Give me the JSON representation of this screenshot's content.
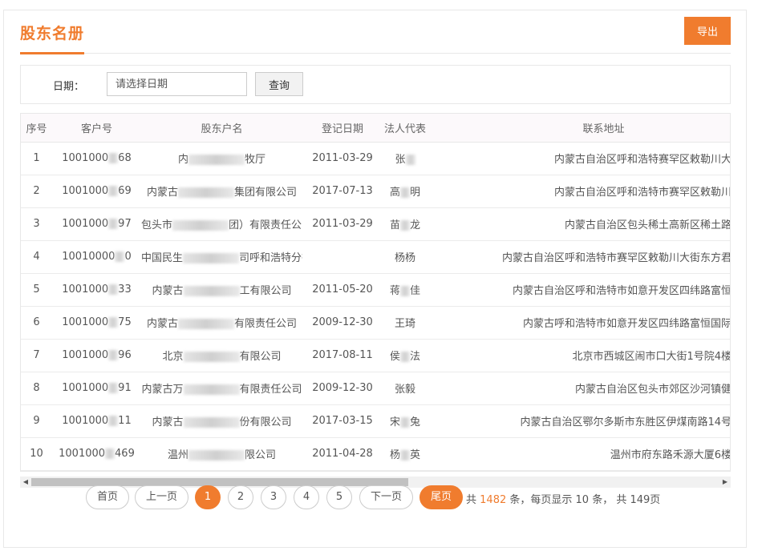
{
  "page": {
    "title": "股东名册",
    "export_label": "导出"
  },
  "filter": {
    "date_label": "日期：",
    "date_placeholder": "请选择日期",
    "query_label": "查询"
  },
  "table": {
    "columns": [
      "序号",
      "客户号",
      "股东户名",
      "登记日期",
      "法人代表",
      "联系地址"
    ],
    "rows": [
      {
        "idx": "1",
        "cid_a": "1001000",
        "cid_b": "68",
        "name_a": "内",
        "name_b": "牧厅",
        "date": "2011-03-29",
        "rep_a": "张",
        "rep_b": "",
        "addr": "内蒙古自治区呼和浩特赛罕区敕勒川大"
      },
      {
        "idx": "2",
        "cid_a": "1001000",
        "cid_b": "69",
        "name_a": "内蒙古",
        "name_b": "集团有限公司",
        "date": "2017-07-13",
        "rep_a": "高",
        "rep_b": "明",
        "addr": "内蒙古自治区呼和浩特市赛罕区敕勒川"
      },
      {
        "idx": "3",
        "cid_a": "1001000",
        "cid_b": "97",
        "name_a": "包头市",
        "name_b": "团）有限责任公司",
        "date": "2011-03-29",
        "rep_a": "苗",
        "rep_b": "龙",
        "addr": "内蒙古自治区包头稀土高新区稀土路"
      },
      {
        "idx": "4",
        "cid_a": "10010000",
        "cid_b": "0",
        "name_a": "中国民生",
        "name_b": "司呼和浩特分行",
        "date": "",
        "rep_a": "杨杨",
        "rep_b": "",
        "addr": "内蒙古自治区呼和浩特市赛罕区敕勒川大街东方君"
      },
      {
        "idx": "5",
        "cid_a": "1001000",
        "cid_b": "33",
        "name_a": "内蒙古",
        "name_b": "工有限公司",
        "date": "2011-05-20",
        "rep_a": "蒋",
        "rep_b": "佳",
        "addr": "内蒙古自治区呼和浩特市如意开发区四纬路富恒"
      },
      {
        "idx": "6",
        "cid_a": "1001000",
        "cid_b": "75",
        "name_a": "内蒙古",
        "name_b": "有限责任公司",
        "date": "2009-12-30",
        "rep_a": "王琦",
        "rep_b": "",
        "addr": "内蒙古呼和浩特市如意开发区四纬路富恒国际"
      },
      {
        "idx": "7",
        "cid_a": "1001000",
        "cid_b": "96",
        "name_a": "北京",
        "name_b": "有限公司",
        "date": "2017-08-11",
        "rep_a": "侯",
        "rep_b": "法",
        "addr": "北京市西城区闹市口大街1号院4楼"
      },
      {
        "idx": "8",
        "cid_a": "1001000",
        "cid_b": "91",
        "name_a": "内蒙古万",
        "name_b": "有限责任公司",
        "date": "2009-12-30",
        "rep_a": "张毅",
        "rep_b": "",
        "addr": "内蒙古自治区包头市郊区沙河镇健"
      },
      {
        "idx": "9",
        "cid_a": "1001000",
        "cid_b": "11",
        "name_a": "内蒙古",
        "name_b": "份有限公司",
        "date": "2017-03-15",
        "rep_a": "宋",
        "rep_b": "兔",
        "addr": "内蒙古自治区鄂尔多斯市东胜区伊煤南路14号"
      },
      {
        "idx": "10",
        "cid_a": "1001000",
        "cid_b": "469",
        "name_a": "温州",
        "name_b": "限公司",
        "date": "2011-04-28",
        "rep_a": "杨",
        "rep_b": "英",
        "addr": "温州市府东路禾源大厦6楼"
      }
    ]
  },
  "pager": {
    "first": "首页",
    "prev": "上一页",
    "pages": [
      "1",
      "2",
      "3",
      "4",
      "5"
    ],
    "current": "1",
    "next": "下一页",
    "last": "尾页",
    "info_prefix": "共",
    "total": "1482",
    "info_mid": "条，每页显示 10 条， 共 149页"
  },
  "colors": {
    "accent": "#f07c2e"
  }
}
